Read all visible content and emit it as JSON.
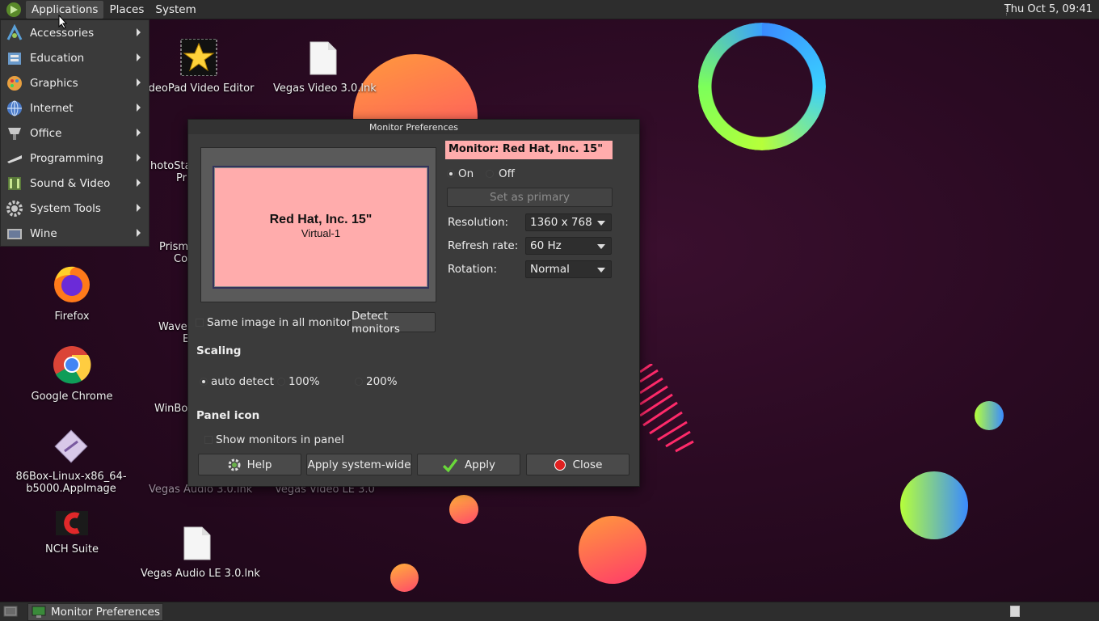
{
  "top_panel": {
    "menus": [
      "Applications",
      "Places",
      "System"
    ],
    "clock": "Thu Oct  5, 09:41"
  },
  "apps_menu": {
    "items": [
      {
        "label": "Accessories",
        "icon": "accessories-icon"
      },
      {
        "label": "Education",
        "icon": "education-icon"
      },
      {
        "label": "Graphics",
        "icon": "graphics-icon"
      },
      {
        "label": "Internet",
        "icon": "internet-icon"
      },
      {
        "label": "Office",
        "icon": "office-icon"
      },
      {
        "label": "Programming",
        "icon": "programming-icon"
      },
      {
        "label": "Sound & Video",
        "icon": "sound-video-icon"
      },
      {
        "label": "System Tools",
        "icon": "system-tools-icon"
      },
      {
        "label": "Wine",
        "icon": "wine-icon"
      }
    ]
  },
  "desktop_icons": [
    {
      "label": "Firefox"
    },
    {
      "label": "Google Chrome"
    },
    {
      "label": "86Box-Linux-x86_64-",
      "label2": "b5000.AppImage"
    },
    {
      "label": "NCH Suite"
    },
    {
      "label": "ideoPad Video Editor"
    },
    {
      "label": "Vegas Video 3.0.lnk"
    },
    {
      "label": "hotoSta"
    },
    {
      "label": "Pr"
    },
    {
      "label": "Prism"
    },
    {
      "label": "Co"
    },
    {
      "label": "Wave"
    },
    {
      "label": "E"
    },
    {
      "label": "WinBo"
    },
    {
      "label": "Vegas Audio 3.0.lnk"
    },
    {
      "label": "Vegas Video LE 3.0"
    },
    {
      "label": "Vegas Audio LE 3.0.lnk"
    }
  ],
  "dialog": {
    "title": "Monitor Preferences",
    "preview": {
      "name": "Red Hat, Inc. 15\"",
      "output": "Virtual-1"
    },
    "monitor_label": "Monitor: Red Hat, Inc. 15\"",
    "power": {
      "on_label": "On",
      "off_label": "Off",
      "selected": "On"
    },
    "set_primary_label": "Set as primary",
    "resolution": {
      "label": "Resolution:",
      "value": "1360 x 768"
    },
    "refresh": {
      "label": "Refresh rate:",
      "value": "60 Hz"
    },
    "rotation": {
      "label": "Rotation:",
      "value": "Normal"
    },
    "same_image_label": "Same image in all monitors",
    "detect_label": "Detect monitors",
    "scaling": {
      "title": "Scaling",
      "options": [
        "auto detect",
        "100%",
        "200%"
      ],
      "selected": "auto detect"
    },
    "panel_icon": {
      "title": "Panel icon",
      "show_label": "Show monitors in panel"
    },
    "buttons": {
      "help": "Help",
      "apply_system": "Apply system-wide",
      "apply": "Apply",
      "close": "Close"
    }
  },
  "taskbar": {
    "window_label": "Monitor Preferences"
  },
  "colors": {
    "monitor_highlight": "#ffacac",
    "panel": "#2d2d2d",
    "dialog": "#3b3b3b"
  }
}
